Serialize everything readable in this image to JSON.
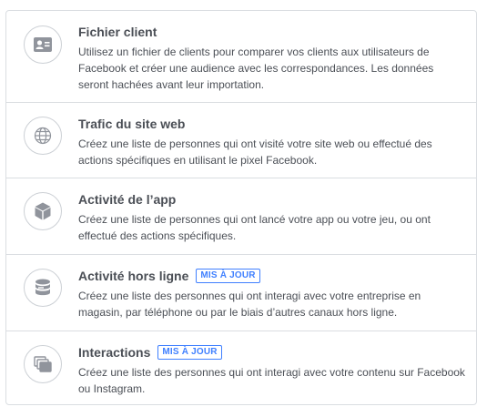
{
  "options": [
    {
      "title": "Fichier client",
      "badge": "",
      "icon": "contact-card-icon",
      "description": "Utilisez un fichier de clients pour comparer vos clients aux utilisateurs de Facebook et créer une audience avec les correspondances. Les données seront hachées avant leur importation."
    },
    {
      "title": "Trafic du site web",
      "badge": "",
      "icon": "globe-icon",
      "description": "Créez une liste de personnes qui ont visité votre site web ou effectué des actions spécifiques en utilisant le pixel Facebook."
    },
    {
      "title": "Activité de l’app",
      "badge": "",
      "icon": "cube-icon",
      "description": "Créez une liste de personnes qui ont lancé votre app ou votre jeu, ou ont effectué des actions spécifiques."
    },
    {
      "title": "Activité hors ligne",
      "badge": "MIS À JOUR",
      "icon": "database-icon",
      "description": "Créez une liste des personnes qui ont interagi avec votre entreprise en magasin, par téléphone ou par le biais d’autres canaux hors ligne."
    },
    {
      "title": "Interactions",
      "badge": "MIS À JOUR",
      "icon": "stacked-cards-icon",
      "description": "Créez une liste des personnes qui ont interagi avec votre contenu sur Facebook ou Instagram."
    }
  ],
  "colors": {
    "border": "#dadde1",
    "icon": "#90949c",
    "badge": "#4080ff",
    "text": "#4b4f56"
  }
}
